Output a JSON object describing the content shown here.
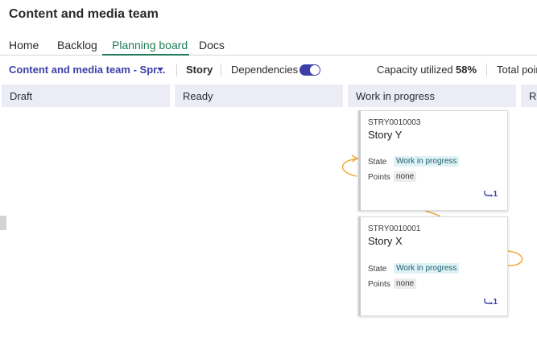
{
  "header": {
    "team_title": "Content and media team"
  },
  "tabs": [
    {
      "label": "Home"
    },
    {
      "label": "Backlog"
    },
    {
      "label": "Planning board",
      "active": true
    },
    {
      "label": "Docs"
    }
  ],
  "toolbar": {
    "sprint_label": "Content and media team - Spr...",
    "type_label": "Story",
    "dependencies_label": "Dependencies",
    "dependencies_enabled": true,
    "capacity_label": "Capacity utilized",
    "capacity_value": "58%",
    "total_points_label": "Total poin"
  },
  "columns": [
    {
      "label": "Draft"
    },
    {
      "label": "Ready"
    },
    {
      "label": "Work in progress"
    },
    {
      "label": "Re"
    }
  ],
  "cards": [
    {
      "number": "STRY0010003",
      "title": "Story Y",
      "state_label": "State",
      "state_value": "Work in progress",
      "points_label": "Points",
      "points_value": "none",
      "dependency_count": "1"
    },
    {
      "number": "STRY0010001",
      "title": "Story X",
      "state_label": "State",
      "state_value": "Work in progress",
      "points_label": "Points",
      "points_value": "none",
      "dependency_count": "1"
    }
  ],
  "colors": {
    "accent_indigo": "#3c3fa8",
    "tab_active_green": "#1f7a55",
    "column_header_bg": "#ececf6",
    "dependency_line": "#f2a93b",
    "state_badge_bg": "#dff2f5"
  },
  "icons": [
    "dropdown-caret-icon",
    "dependency-link-icon",
    "toggle-switch"
  ]
}
